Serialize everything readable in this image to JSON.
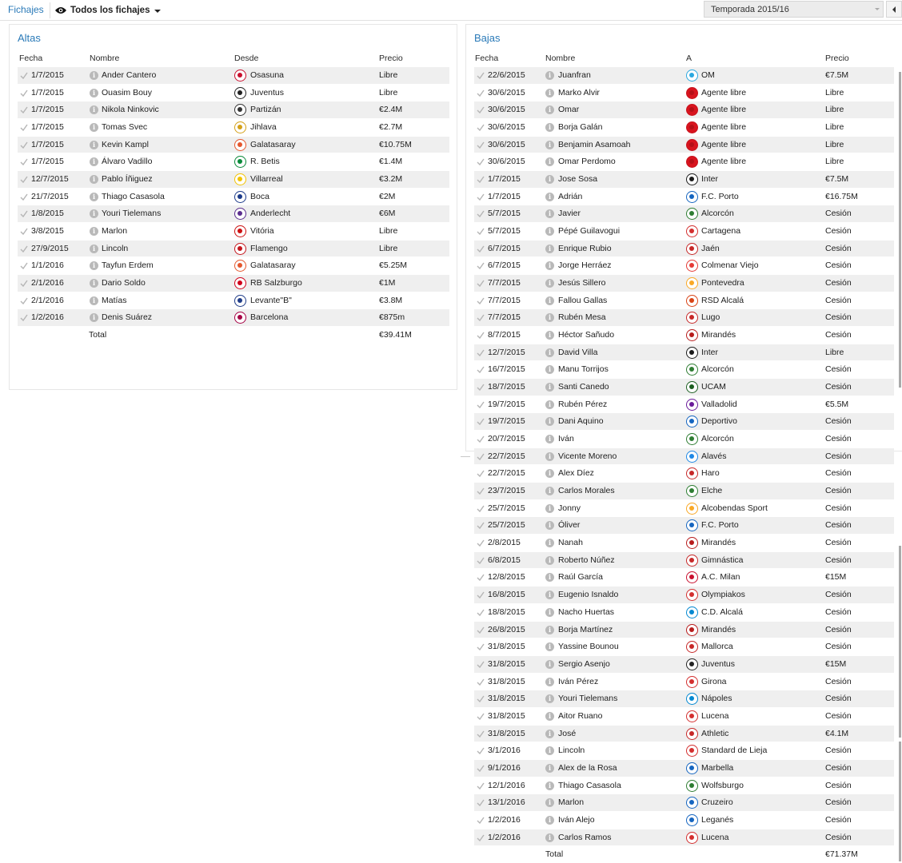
{
  "header": {
    "tab_label": "Fichajes",
    "view_label": "Todos los fichajes",
    "season_label": "Temporada 2015/16"
  },
  "altas": {
    "title": "Altas",
    "columns": {
      "fecha": "Fecha",
      "nombre": "Nombre",
      "club": "Desde",
      "precio": "Precio"
    },
    "rows": [
      {
        "fecha": "1/7/2015",
        "nombre": "Ander Cantero",
        "club": "Osasuna",
        "precio": "Libre",
        "color": "#c8102e"
      },
      {
        "fecha": "1/7/2015",
        "nombre": "Ouasim Bouy",
        "club": "Juventus",
        "precio": "Libre",
        "color": "#222222"
      },
      {
        "fecha": "1/7/2015",
        "nombre": "Nikola Ninkovic",
        "club": "Partizán",
        "precio": "€2.4M",
        "color": "#333333"
      },
      {
        "fecha": "1/7/2015",
        "nombre": "Tomas Svec",
        "club": "Jihlava",
        "precio": "€2.7M",
        "color": "#d4a017"
      },
      {
        "fecha": "1/7/2015",
        "nombre": "Kevin Kampl",
        "club": "Galatasaray",
        "precio": "€10.75M",
        "color": "#e4572e"
      },
      {
        "fecha": "1/7/2015",
        "nombre": "Álvaro Vadillo",
        "club": "R. Betis",
        "precio": "€1.4M",
        "color": "#0a8a3a"
      },
      {
        "fecha": "12/7/2015",
        "nombre": "Pablo Íñiguez",
        "club": "Villarreal",
        "precio": "€3.2M",
        "color": "#f2c300"
      },
      {
        "fecha": "21/7/2015",
        "nombre": "Thiago Casasola",
        "club": "Boca",
        "precio": "€2M",
        "color": "#1b3a8a"
      },
      {
        "fecha": "1/8/2015",
        "nombre": "Youri Tielemans",
        "club": "Anderlecht",
        "precio": "€6M",
        "color": "#5b2d8e"
      },
      {
        "fecha": "3/8/2015",
        "nombre": "Marlon",
        "club": "Vitória",
        "precio": "Libre",
        "color": "#cc1111"
      },
      {
        "fecha": "27/9/2015",
        "nombre": "Lincoln",
        "club": "Flamengo",
        "precio": "Libre",
        "color": "#c4151c"
      },
      {
        "fecha": "1/1/2016",
        "nombre": "Tayfun Erdem",
        "club": "Galatasaray",
        "precio": "€5.25M",
        "color": "#e4572e"
      },
      {
        "fecha": "2/1/2016",
        "nombre": "Dario Soldo",
        "club": "RB Salzburgo",
        "precio": "€1M",
        "color": "#d0021b"
      },
      {
        "fecha": "2/1/2016",
        "nombre": "Matías",
        "club": "Levante\"B\"",
        "precio": "€3.8M",
        "color": "#1f3c88"
      },
      {
        "fecha": "1/2/2016",
        "nombre": "Denis Suárez",
        "club": "Barcelona",
        "precio": "€875m",
        "color": "#a50044"
      }
    ],
    "total_label": "Total",
    "total_value": "€39.41M"
  },
  "bajas": {
    "title": "Bajas",
    "columns": {
      "fecha": "Fecha",
      "nombre": "Nombre",
      "club": "A",
      "precio": "Precio"
    },
    "rows": [
      {
        "fecha": "22/6/2015",
        "nombre": "Juanfran",
        "club": "OM",
        "precio": "€7.5M",
        "color": "#2aa8e0"
      },
      {
        "fecha": "30/6/2015",
        "nombre": "Marko Alvir",
        "club": "Agente libre",
        "precio": "Libre",
        "color": "red"
      },
      {
        "fecha": "30/6/2015",
        "nombre": "Omar",
        "club": "Agente libre",
        "precio": "Libre",
        "color": "red"
      },
      {
        "fecha": "30/6/2015",
        "nombre": "Borja Galán",
        "club": "Agente libre",
        "precio": "Libre",
        "color": "red"
      },
      {
        "fecha": "30/6/2015",
        "nombre": "Benjamin Asamoah",
        "club": "Agente libre",
        "precio": "Libre",
        "color": "red"
      },
      {
        "fecha": "30/6/2015",
        "nombre": "Omar Perdomo",
        "club": "Agente libre",
        "precio": "Libre",
        "color": "red"
      },
      {
        "fecha": "1/7/2015",
        "nombre": "Jose Sosa",
        "club": "Inter",
        "precio": "€7.5M",
        "color": "#1a1a1a"
      },
      {
        "fecha": "1/7/2015",
        "nombre": "Adrián",
        "club": "F.C. Porto",
        "precio": "€16.75M",
        "color": "#1565c0"
      },
      {
        "fecha": "5/7/2015",
        "nombre": "Javier",
        "club": "Alcorcón",
        "precio": "Cesión",
        "color": "#2e7d32"
      },
      {
        "fecha": "5/7/2015",
        "nombre": "Pépé Guilavogui",
        "club": "Cartagena",
        "precio": "Cesión",
        "color": "#d32f2f"
      },
      {
        "fecha": "6/7/2015",
        "nombre": "Enrique Rubio",
        "club": "Jaén",
        "precio": "Cesión",
        "color": "#c62828"
      },
      {
        "fecha": "6/7/2015",
        "nombre": "Jorge Herráez",
        "club": "Colmenar Viejo",
        "precio": "Cesión",
        "color": "#e53935"
      },
      {
        "fecha": "7/7/2015",
        "nombre": "Jesús Sillero",
        "club": "Pontevedra",
        "precio": "Cesión",
        "color": "#f9a825"
      },
      {
        "fecha": "7/7/2015",
        "nombre": "Fallou Gallas",
        "club": "RSD Alcalá",
        "precio": "Cesión",
        "color": "#d84315"
      },
      {
        "fecha": "7/7/2015",
        "nombre": "Rubén Mesa",
        "club": "Lugo",
        "precio": "Cesión",
        "color": "#c62828"
      },
      {
        "fecha": "8/7/2015",
        "nombre": "Héctor Sañudo",
        "club": "Mirandés",
        "precio": "Cesión",
        "color": "#b71c1c"
      },
      {
        "fecha": "12/7/2015",
        "nombre": "David Villa",
        "club": "Inter",
        "precio": "Libre",
        "color": "#1a1a1a"
      },
      {
        "fecha": "16/7/2015",
        "nombre": "Manu Torrijos",
        "club": "Alcorcón",
        "precio": "Cesión",
        "color": "#2e7d32"
      },
      {
        "fecha": "18/7/2015",
        "nombre": "Santi Canedo",
        "club": "UCAM",
        "precio": "Cesión",
        "color": "#1b5e20"
      },
      {
        "fecha": "19/7/2015",
        "nombre": "Rubén Pérez",
        "club": "Valladolid",
        "precio": "€5.5M",
        "color": "#6a1b9a"
      },
      {
        "fecha": "19/7/2015",
        "nombre": "Dani Aquino",
        "club": "Deportivo",
        "precio": "Cesión",
        "color": "#1565c0"
      },
      {
        "fecha": "20/7/2015",
        "nombre": "Iván",
        "club": "Alcorcón",
        "precio": "Cesión",
        "color": "#2e7d32"
      },
      {
        "fecha": "22/7/2015",
        "nombre": "Vicente Moreno",
        "club": "Alavés",
        "precio": "Cesión",
        "color": "#1e88e5"
      },
      {
        "fecha": "22/7/2015",
        "nombre": "Alex Díez",
        "club": "Haro",
        "precio": "Cesión",
        "color": "#c62828"
      },
      {
        "fecha": "23/7/2015",
        "nombre": "Carlos Morales",
        "club": "Elche",
        "precio": "Cesión",
        "color": "#2e7d32"
      },
      {
        "fecha": "25/7/2015",
        "nombre": "Jonny",
        "club": "Alcobendas Sport",
        "precio": "Cesión",
        "color": "#f9a825"
      },
      {
        "fecha": "25/7/2015",
        "nombre": "Óliver",
        "club": "F.C. Porto",
        "precio": "Cesión",
        "color": "#1565c0"
      },
      {
        "fecha": "2/8/2015",
        "nombre": "Nanah",
        "club": "Mirandés",
        "precio": "Cesión",
        "color": "#b71c1c"
      },
      {
        "fecha": "6/8/2015",
        "nombre": "Roberto Núñez",
        "club": "Gimnástica",
        "precio": "Cesión",
        "color": "#c62828"
      },
      {
        "fecha": "12/8/2015",
        "nombre": "Raúl García",
        "club": "A.C. Milan",
        "precio": "€15M",
        "color": "#c8102e"
      },
      {
        "fecha": "16/8/2015",
        "nombre": "Eugenio Isnaldo",
        "club": "Olympiakos",
        "precio": "Cesión",
        "color": "#d32f2f"
      },
      {
        "fecha": "18/8/2015",
        "nombre": "Nacho Huertas",
        "club": "C.D. Alcalá",
        "precio": "Cesión",
        "color": "#0288d1"
      },
      {
        "fecha": "26/8/2015",
        "nombre": "Borja Martínez",
        "club": "Mirandés",
        "precio": "Cesión",
        "color": "#b71c1c"
      },
      {
        "fecha": "31/8/2015",
        "nombre": "Yassine Bounou",
        "club": "Mallorca",
        "precio": "Cesión",
        "color": "#c62828"
      },
      {
        "fecha": "31/8/2015",
        "nombre": "Sergio Asenjo",
        "club": "Juventus",
        "precio": "€15M",
        "color": "#222222"
      },
      {
        "fecha": "31/8/2015",
        "nombre": "Iván Pérez",
        "club": "Girona",
        "precio": "Cesión",
        "color": "#d32f2f"
      },
      {
        "fecha": "31/8/2015",
        "nombre": "Youri Tielemans",
        "club": "Nápoles",
        "precio": "Cesión",
        "color": "#0288d1"
      },
      {
        "fecha": "31/8/2015",
        "nombre": "Aitor Ruano",
        "club": "Lucena",
        "precio": "Cesión",
        "color": "#d32f2f"
      },
      {
        "fecha": "31/8/2015",
        "nombre": "José",
        "club": "Athletic",
        "precio": "€4.1M",
        "color": "#c62828"
      },
      {
        "fecha": "3/1/2016",
        "nombre": "Lincoln",
        "club": "Standard de Lieja",
        "precio": "Cesión",
        "color": "#d32f2f"
      },
      {
        "fecha": "9/1/2016",
        "nombre": "Alex de la Rosa",
        "club": "Marbella",
        "precio": "Cesión",
        "color": "#1565c0"
      },
      {
        "fecha": "12/1/2016",
        "nombre": "Thiago Casasola",
        "club": "Wolfsburgo",
        "precio": "Cesión",
        "color": "#2e7d32"
      },
      {
        "fecha": "13/1/2016",
        "nombre": "Marlon",
        "club": "Cruzeiro",
        "precio": "Cesión",
        "color": "#1565c0"
      },
      {
        "fecha": "1/2/2016",
        "nombre": "Iván Alejo",
        "club": "Leganés",
        "precio": "Cesión",
        "color": "#1565c0"
      },
      {
        "fecha": "1/2/2016",
        "nombre": "Carlos Ramos",
        "club": "Lucena",
        "precio": "Cesión",
        "color": "#d32f2f"
      }
    ],
    "total_label": "Total",
    "total_value": "€71.37M"
  }
}
